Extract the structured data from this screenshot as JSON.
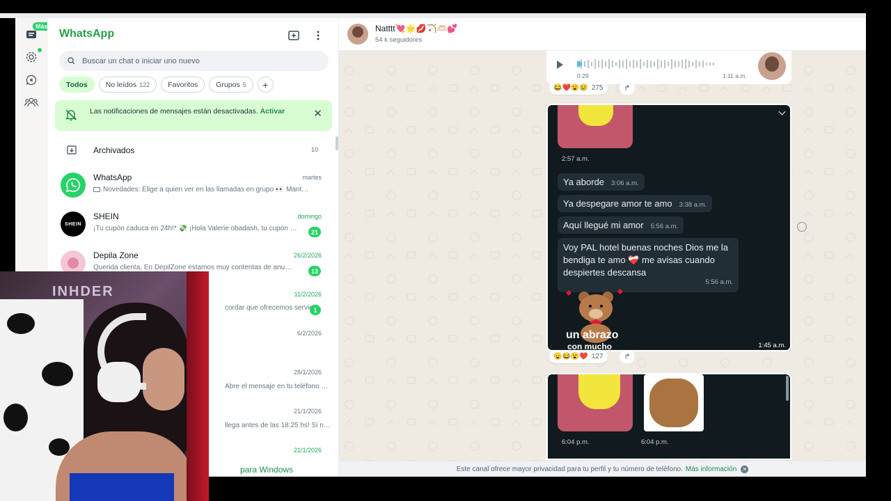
{
  "rail": {
    "mas_badge": "Más"
  },
  "list": {
    "brand": "WhatsApp",
    "search_placeholder": "Buscar un chat o iniciar uno nuevo",
    "chips": [
      {
        "label": "Todos",
        "count": ""
      },
      {
        "label": "No leídos",
        "count": "122"
      },
      {
        "label": "Favoritos",
        "count": ""
      },
      {
        "label": "Grupos",
        "count": "5"
      }
    ],
    "chip_add": "+",
    "notif_text": "Las notificaciones de mensajes están desactivadas.",
    "notif_link": "Activar",
    "notif_close": "✕",
    "archived_label": "Archivados",
    "archived_count": "10",
    "chats": [
      {
        "name": "WhatsApp",
        "preview": "Novedades: Elige a quien ver en las llamadas en grupo 👀 Mant…",
        "time": "martes",
        "badge": ""
      },
      {
        "name": "SHEIN",
        "preview": "¡Tu cupón caduca en 24h!* 💸 ¡Hola Valerie obadash, tu cupón …",
        "time": "domingo",
        "badge": "21"
      },
      {
        "name": "Depila Zone",
        "preview": "Querida clienta, En DepilZone estamos muy contentas de anu…",
        "time": "26/2/2026",
        "badge": "13"
      },
      {
        "name": "",
        "preview": "cordar que ofrecemos servici…",
        "time": "11/2/2026",
        "badge": "1"
      },
      {
        "name": "",
        "preview": "",
        "time": "6/2/2026",
        "badge": ""
      },
      {
        "name": "",
        "preview": "Abre el mensaje en tu teléfono …",
        "time": "28/1/2026",
        "badge": ""
      },
      {
        "name": "",
        "preview": "llega antes de las 18:25 hs! Si n…",
        "time": "21/1/2026",
        "badge": ""
      },
      {
        "name": "",
        "preview": "",
        "time": "21/1/2026",
        "badge": ""
      }
    ],
    "bottom_link": "para Windows",
    "shein_logo": "SHEIN"
  },
  "pane": {
    "title": "Natttt💘🌟💋🏹🫶🏻💕",
    "subtitle": "54 k seguidores",
    "audio_duration": "0:29",
    "audio_time": "1:11 a.m.",
    "reactions1_emojis": "😂❤️😮😢",
    "reactions1_count": "275",
    "fwd_icon": "↱",
    "stamp1": "2:57 a.m.",
    "bubbles": [
      {
        "text": "Ya aborde",
        "time": "3:06 a.m."
      },
      {
        "text": "Ya despegare amor te amo",
        "time": "3:38 a.m."
      },
      {
        "text": "Aquí llegué mi amor",
        "time": "5:56 a.m."
      },
      {
        "text": "Voy PAL hotel buenas noches Dios me la bendiga te amo ❤️‍🩹 me avisas cuando despiertes descansa",
        "time": "5:56 a.m."
      }
    ],
    "sticker_text": "un abrazo",
    "sticker_text2": "con mucho",
    "img1_time": "1:45 a.m.",
    "reactions2_emojis": "😦😂😮❤️",
    "reactions2_count": "127",
    "img2_time_a": "6:04 p.m.",
    "img2_time_b": "6:04 p.m.",
    "footer_text": "Este canal ofrece mayor privacidad para tu perfil y tu número de teléfono.",
    "footer_link": "Más información",
    "footer_close": "✕"
  },
  "webcam": {
    "sign_text": "INHDER"
  },
  "colors": {
    "accent": "#25d366",
    "brand": "#25a244",
    "bubble": "#222e35"
  }
}
